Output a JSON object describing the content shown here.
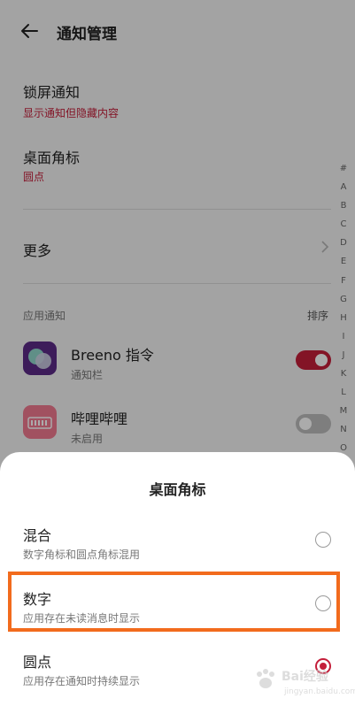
{
  "header": {
    "title": "通知管理",
    "back_icon": "arrow-left-icon"
  },
  "lock_screen": {
    "title": "锁屏通知",
    "value": "显示通知但隐藏内容"
  },
  "badge": {
    "title": "桌面角标",
    "value": "圆点"
  },
  "more": {
    "title": "更多"
  },
  "app_section": {
    "label": "应用通知",
    "sort": "排序"
  },
  "apps": [
    {
      "name": "Breeno 指令",
      "status": "通知栏",
      "enabled": true
    },
    {
      "name": "哔哩哔哩",
      "status": "未启用",
      "enabled": false
    }
  ],
  "alphabet": [
    "#",
    "A",
    "B",
    "C",
    "D",
    "E",
    "F",
    "G",
    "H",
    "I",
    "J",
    "K",
    "L",
    "M",
    "N",
    "O"
  ],
  "sheet": {
    "title": "桌面角标",
    "options": [
      {
        "label": "混合",
        "desc": "数字角标和圆点角标混用",
        "selected": false
      },
      {
        "label": "数字",
        "desc": "应用存在未读消息时显示",
        "selected": false
      },
      {
        "label": "圆点",
        "desc": "应用存在通知时持续显示",
        "selected": true
      }
    ]
  },
  "colors": {
    "accent": "#c41e3a",
    "highlight": "#f26b1d"
  },
  "watermark": {
    "text": "Bai经验",
    "sub": "jingyan.baidu.com"
  }
}
